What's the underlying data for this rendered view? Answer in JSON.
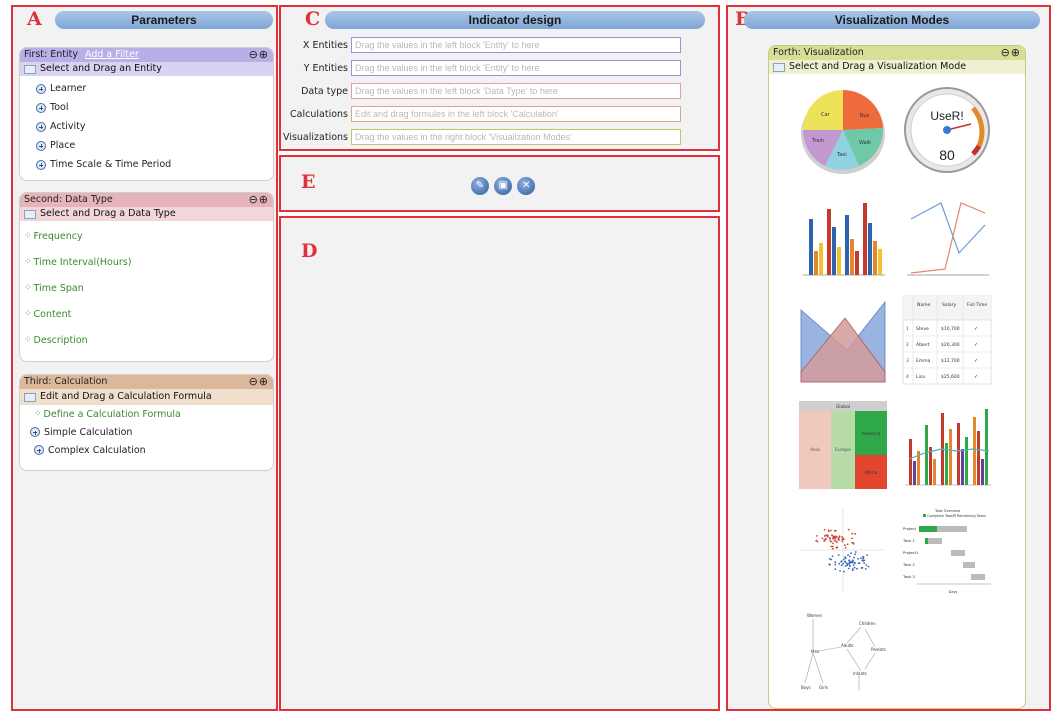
{
  "panels": {
    "a": {
      "letter": "A",
      "title": "Parameters"
    },
    "b": {
      "letter": "B",
      "title": "Visualization Modes"
    },
    "c": {
      "letter": "C",
      "title": "Indicator design"
    },
    "d": {
      "letter": "D"
    },
    "e": {
      "letter": "E"
    }
  },
  "entity_box": {
    "header": "First: Entity",
    "add_filter": "Add a Filter",
    "subheader": "Select and Drag an Entity",
    "items": [
      "Learner",
      "Tool",
      "Activity",
      "Place",
      "Time Scale & Time Period"
    ]
  },
  "datatype_box": {
    "header": "Second: Data Type",
    "subheader": "Select and Drag a Data Type",
    "items": [
      "Frequency",
      "Time Interval(Hours)",
      "Time Span",
      "Content",
      "Description"
    ]
  },
  "calc_box": {
    "header": "Third: Calculation",
    "subheader": "Edit and Drag a Calculation Formula",
    "define": "Define a Calculation Formula",
    "items": [
      "Simple Calculation",
      "Complex Calculation"
    ]
  },
  "indicator": {
    "fields": [
      {
        "label": "X Entities",
        "placeholder": "Drag the values in the left block 'Entity' to here"
      },
      {
        "label": "Y Entities",
        "placeholder": "Drag the values in the left block 'Entity' to here"
      },
      {
        "label": "Data type",
        "placeholder": "Drag the values in the left block 'Data Type' to here"
      },
      {
        "label": "Calculations",
        "placeholder": "Edit and drag formules in the left block 'Calculation'"
      },
      {
        "label": "Visualizations",
        "placeholder": "Drag the values in the right block 'Visualization Modes'"
      }
    ]
  },
  "toolbar": {
    "icons": [
      "pencil-icon",
      "save-icon",
      "close-icon"
    ],
    "glyph_edit": "✎",
    "glyph_save": "▣",
    "glyph_close": "✕"
  },
  "visualization_box": {
    "header": "Forth: Visualization",
    "subheader": "Select and Drag a Visualization Mode",
    "pie_labels": [
      "Car",
      "Bus",
      "Walk",
      "Taxi",
      "Train"
    ],
    "gauge_label": "UseR!",
    "gauge_value": "80",
    "table": {
      "headers": [
        "Name",
        "Salary",
        "Full Time"
      ],
      "rows": [
        [
          "1",
          "Steve",
          "$10,700",
          "✓"
        ],
        [
          "2",
          "Albert",
          "$20,300",
          "✓"
        ],
        [
          "3",
          "Emma",
          "$12,700",
          "✓"
        ],
        [
          "4",
          "Lisa",
          "$25,600",
          "✓"
        ]
      ]
    },
    "treemap": {
      "title": "Global",
      "cells": [
        "Asia",
        "Europe",
        "America",
        "Africa"
      ]
    },
    "gantt": {
      "legend": [
        "Task Overview",
        "Complete Tasks",
        "Remaining Tasks"
      ],
      "rows": [
        "Project",
        "Task 1",
        "Project1",
        "Task 2",
        "Task 3"
      ],
      "x_label": "Days"
    },
    "graph_nodes": [
      "Women",
      "Men",
      "Boys",
      "Girls",
      "Adults",
      "Children",
      "Infants",
      "Parents"
    ]
  },
  "colors": {
    "panel_border": "#e0303a",
    "entity_header": "#b9aee6",
    "datatype_header": "#e6b4b8",
    "calc_header": "#dcb89a",
    "visualization_header": "#d8de96",
    "pill": "#8eb1dd"
  }
}
